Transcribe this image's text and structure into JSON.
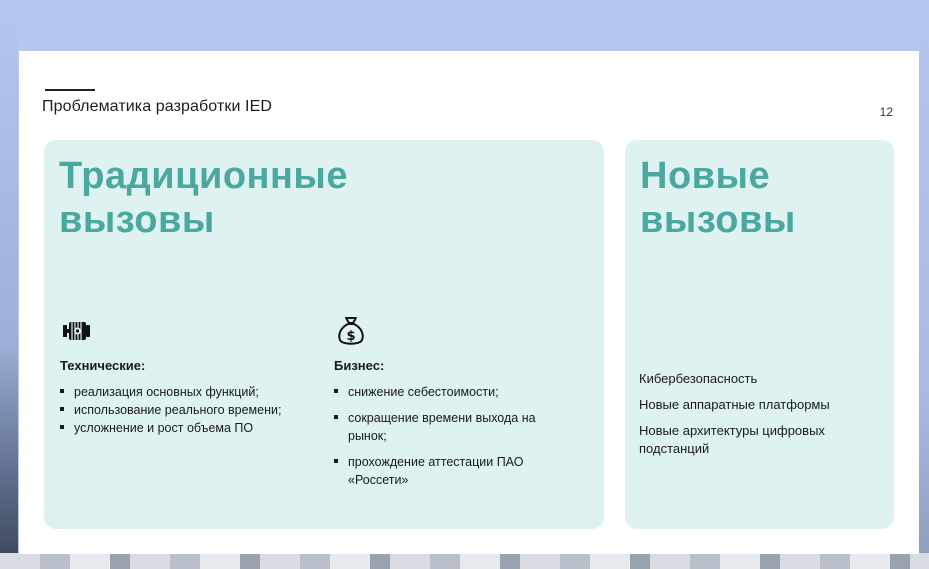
{
  "slide": {
    "title": "Проблематика разработки IED",
    "page_number": "12"
  },
  "traditional": {
    "heading_line1": "Традиционные",
    "heading_line2": "вызовы",
    "technical": {
      "icon": "engine-icon",
      "title": "Технические:",
      "items": [
        "реализация основных функций;",
        "использование реального времени;",
        "усложнение и рост объема ПО"
      ]
    },
    "business": {
      "icon": "money-bag-icon",
      "title": "Бизнес:",
      "items": [
        "снижение себестоимости;",
        "сокращение времени выхода на рынок;",
        "прохождение аттестации ПАО «Россети»"
      ]
    }
  },
  "new_challenges": {
    "heading_line1": "Новые",
    "heading_line2": "вызовы",
    "items": [
      "Кибербезопасность",
      "Новые аппаратные платформы",
      "Новые архитектуры цифровых подстанций"
    ]
  },
  "colors": {
    "accent": "#4aa89e",
    "card_background": "#def2f1",
    "page_background": "#b6c6ee"
  }
}
